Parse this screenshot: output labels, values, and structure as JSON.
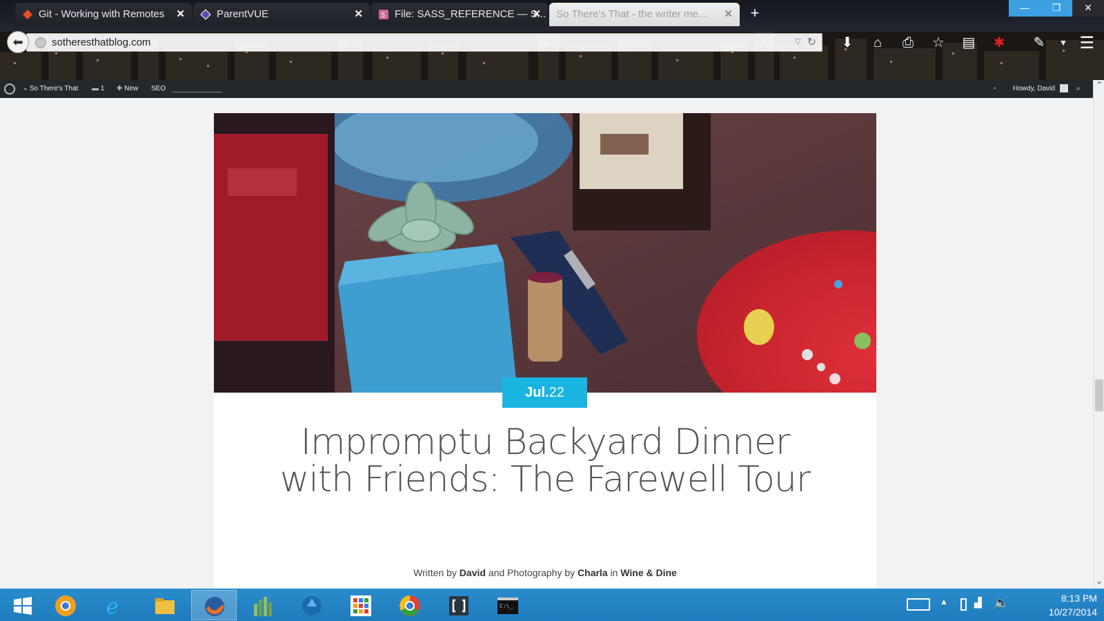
{
  "browser": {
    "tabs": [
      {
        "label": "Git - Working with Remotes",
        "favicon": "git-icon",
        "active": false
      },
      {
        "label": "ParentVUE",
        "favicon": "parentvue-icon",
        "active": false
      },
      {
        "label": "File: SASS_REFERENCE — S...",
        "favicon": "sass-icon",
        "active": false
      },
      {
        "label": "So There's That - the writer me...",
        "favicon": "",
        "active": true
      }
    ],
    "new_tab": "+",
    "url": "sotheresthatblog.com",
    "window_controls": {
      "minimize": "—",
      "maximize": "❐",
      "close": "✕"
    }
  },
  "adminbar": {
    "site_name": "So There's That",
    "comments_count": "1",
    "new_label": "New",
    "seo_label": "SEO",
    "howdy": "Howdy, David"
  },
  "post": {
    "date_month": "Jul.",
    "date_day": "22",
    "title": "Impromptu Backyard Dinner with Friends: The Farewell Tour",
    "byline_prefix": "Written by",
    "author": "David",
    "byline_mid": "and Photography by",
    "photographer": "Charla",
    "byline_in": "in",
    "category": "Wine & Dine"
  },
  "taskbar": {
    "items": [
      "start-icon",
      "chrome-canary-icon",
      "internet-explorer-icon",
      "file-explorer-icon",
      "firefox-icon",
      "chart-app-icon",
      "blue-app-icon",
      "apps-grid-icon",
      "chrome-icon",
      "brackets-icon",
      "command-prompt-icon"
    ],
    "active_item": "firefox-icon",
    "time": "8:13 PM",
    "date": "10/27/2014"
  },
  "colors": {
    "accent_badge": "#1ab4e0",
    "taskbar": "#2a8ccc",
    "adminbar": "#23282d"
  }
}
